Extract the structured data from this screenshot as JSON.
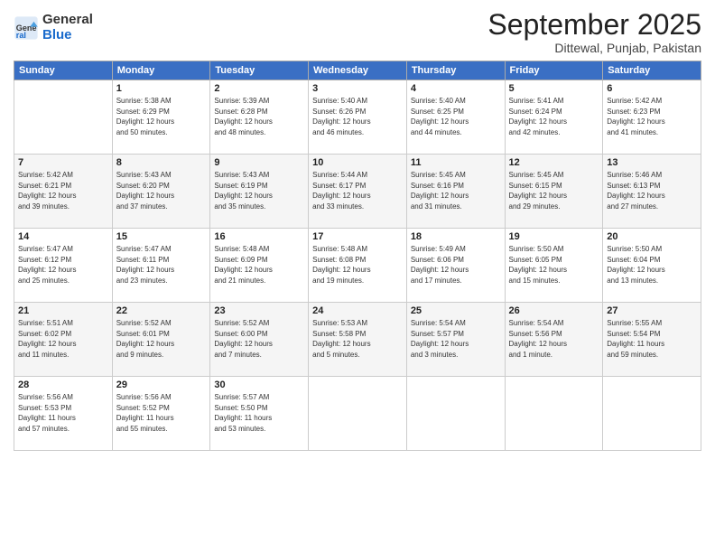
{
  "header": {
    "logo_line1": "General",
    "logo_line2": "Blue",
    "month": "September 2025",
    "location": "Dittewal, Punjab, Pakistan"
  },
  "weekdays": [
    "Sunday",
    "Monday",
    "Tuesday",
    "Wednesday",
    "Thursday",
    "Friday",
    "Saturday"
  ],
  "weeks": [
    [
      {
        "day": "",
        "info": ""
      },
      {
        "day": "1",
        "info": "Sunrise: 5:38 AM\nSunset: 6:29 PM\nDaylight: 12 hours\nand 50 minutes."
      },
      {
        "day": "2",
        "info": "Sunrise: 5:39 AM\nSunset: 6:28 PM\nDaylight: 12 hours\nand 48 minutes."
      },
      {
        "day": "3",
        "info": "Sunrise: 5:40 AM\nSunset: 6:26 PM\nDaylight: 12 hours\nand 46 minutes."
      },
      {
        "day": "4",
        "info": "Sunrise: 5:40 AM\nSunset: 6:25 PM\nDaylight: 12 hours\nand 44 minutes."
      },
      {
        "day": "5",
        "info": "Sunrise: 5:41 AM\nSunset: 6:24 PM\nDaylight: 12 hours\nand 42 minutes."
      },
      {
        "day": "6",
        "info": "Sunrise: 5:42 AM\nSunset: 6:23 PM\nDaylight: 12 hours\nand 41 minutes."
      }
    ],
    [
      {
        "day": "7",
        "info": "Sunrise: 5:42 AM\nSunset: 6:21 PM\nDaylight: 12 hours\nand 39 minutes."
      },
      {
        "day": "8",
        "info": "Sunrise: 5:43 AM\nSunset: 6:20 PM\nDaylight: 12 hours\nand 37 minutes."
      },
      {
        "day": "9",
        "info": "Sunrise: 5:43 AM\nSunset: 6:19 PM\nDaylight: 12 hours\nand 35 minutes."
      },
      {
        "day": "10",
        "info": "Sunrise: 5:44 AM\nSunset: 6:17 PM\nDaylight: 12 hours\nand 33 minutes."
      },
      {
        "day": "11",
        "info": "Sunrise: 5:45 AM\nSunset: 6:16 PM\nDaylight: 12 hours\nand 31 minutes."
      },
      {
        "day": "12",
        "info": "Sunrise: 5:45 AM\nSunset: 6:15 PM\nDaylight: 12 hours\nand 29 minutes."
      },
      {
        "day": "13",
        "info": "Sunrise: 5:46 AM\nSunset: 6:13 PM\nDaylight: 12 hours\nand 27 minutes."
      }
    ],
    [
      {
        "day": "14",
        "info": "Sunrise: 5:47 AM\nSunset: 6:12 PM\nDaylight: 12 hours\nand 25 minutes."
      },
      {
        "day": "15",
        "info": "Sunrise: 5:47 AM\nSunset: 6:11 PM\nDaylight: 12 hours\nand 23 minutes."
      },
      {
        "day": "16",
        "info": "Sunrise: 5:48 AM\nSunset: 6:09 PM\nDaylight: 12 hours\nand 21 minutes."
      },
      {
        "day": "17",
        "info": "Sunrise: 5:48 AM\nSunset: 6:08 PM\nDaylight: 12 hours\nand 19 minutes."
      },
      {
        "day": "18",
        "info": "Sunrise: 5:49 AM\nSunset: 6:06 PM\nDaylight: 12 hours\nand 17 minutes."
      },
      {
        "day": "19",
        "info": "Sunrise: 5:50 AM\nSunset: 6:05 PM\nDaylight: 12 hours\nand 15 minutes."
      },
      {
        "day": "20",
        "info": "Sunrise: 5:50 AM\nSunset: 6:04 PM\nDaylight: 12 hours\nand 13 minutes."
      }
    ],
    [
      {
        "day": "21",
        "info": "Sunrise: 5:51 AM\nSunset: 6:02 PM\nDaylight: 12 hours\nand 11 minutes."
      },
      {
        "day": "22",
        "info": "Sunrise: 5:52 AM\nSunset: 6:01 PM\nDaylight: 12 hours\nand 9 minutes."
      },
      {
        "day": "23",
        "info": "Sunrise: 5:52 AM\nSunset: 6:00 PM\nDaylight: 12 hours\nand 7 minutes."
      },
      {
        "day": "24",
        "info": "Sunrise: 5:53 AM\nSunset: 5:58 PM\nDaylight: 12 hours\nand 5 minutes."
      },
      {
        "day": "25",
        "info": "Sunrise: 5:54 AM\nSunset: 5:57 PM\nDaylight: 12 hours\nand 3 minutes."
      },
      {
        "day": "26",
        "info": "Sunrise: 5:54 AM\nSunset: 5:56 PM\nDaylight: 12 hours\nand 1 minute."
      },
      {
        "day": "27",
        "info": "Sunrise: 5:55 AM\nSunset: 5:54 PM\nDaylight: 11 hours\nand 59 minutes."
      }
    ],
    [
      {
        "day": "28",
        "info": "Sunrise: 5:56 AM\nSunset: 5:53 PM\nDaylight: 11 hours\nand 57 minutes."
      },
      {
        "day": "29",
        "info": "Sunrise: 5:56 AM\nSunset: 5:52 PM\nDaylight: 11 hours\nand 55 minutes."
      },
      {
        "day": "30",
        "info": "Sunrise: 5:57 AM\nSunset: 5:50 PM\nDaylight: 11 hours\nand 53 minutes."
      },
      {
        "day": "",
        "info": ""
      },
      {
        "day": "",
        "info": ""
      },
      {
        "day": "",
        "info": ""
      },
      {
        "day": "",
        "info": ""
      }
    ]
  ]
}
